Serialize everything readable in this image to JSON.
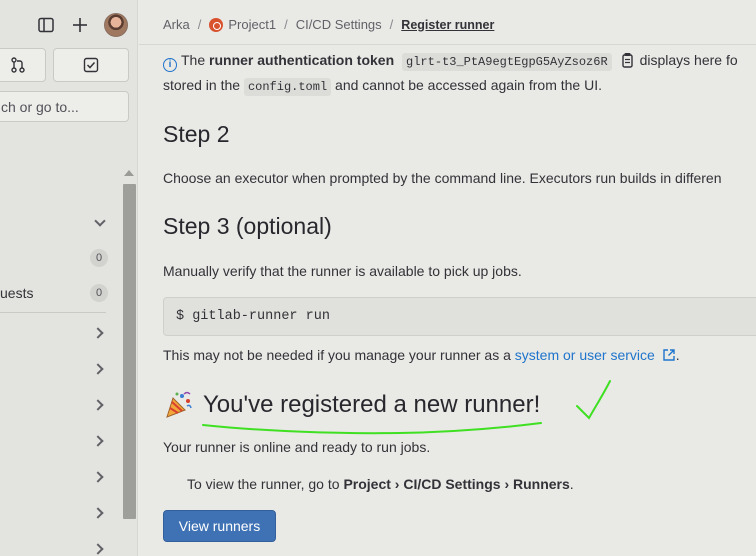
{
  "sidebar": {
    "search_placeholder": "ch or go to...",
    "rows": [
      {
        "label": "",
        "badge": "0"
      },
      {
        "label": "uests",
        "badge": "0"
      }
    ]
  },
  "breadcrumb": {
    "items": [
      "Arka",
      "Project1",
      "CI/CD Settings"
    ],
    "current": "Register runner"
  },
  "token_notice": {
    "prefix": "The ",
    "bold": "runner authentication token",
    "token": "glrt-t3_PtA9egtEgpG5AyZsoz6R",
    "suffix": "displays here fo",
    "line2_prefix": "stored in the ",
    "config_file": "config.toml",
    "line2_suffix": " and cannot be accessed again from the UI."
  },
  "step2": {
    "heading": "Step 2",
    "text": "Choose an executor when prompted by the command line. Executors run builds in differen"
  },
  "step3": {
    "heading": "Step 3 (optional)",
    "text": "Manually verify that the runner is available to pick up jobs.",
    "command": "$ gitlab-runner run",
    "note_prefix": "This may not be needed if you manage your runner as a ",
    "note_link": "system or user service",
    "note_suffix": "."
  },
  "success": {
    "title": "You've registered a new runner!",
    "subtitle": "Your runner is online and ready to run jobs.",
    "view_prefix": "To view the runner, go to ",
    "view_path": "Project › CI/CD Settings › Runners",
    "view_suffix": ".",
    "button": "View runners"
  },
  "colors": {
    "link": "#1f75cb",
    "primary_button": "#3f72b4",
    "annotation": "#3ee021"
  }
}
